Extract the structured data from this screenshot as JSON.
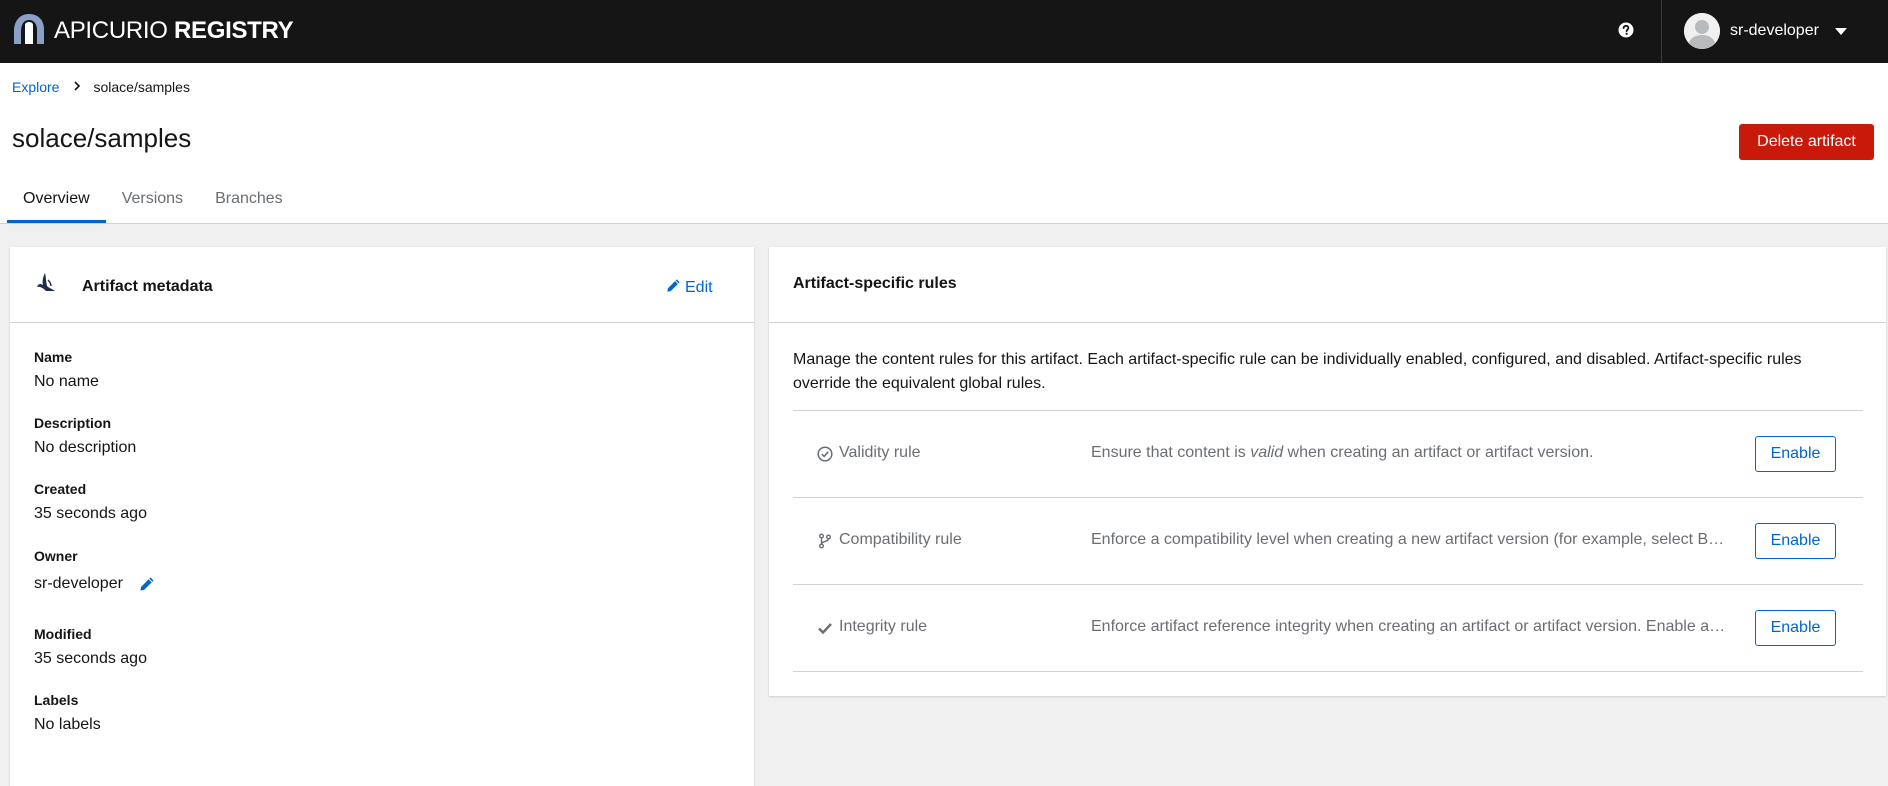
{
  "masthead": {
    "brand_thin": "APICURIO",
    "brand_bold": "REGISTRY",
    "username": "sr-developer",
    "icons": {
      "logo": "apicurio-logo-icon",
      "help": "help-icon",
      "avatar": "avatar-icon",
      "caret": "caret-down-icon"
    }
  },
  "breadcrumb": {
    "root": "Explore",
    "current": "solace/samples"
  },
  "page": {
    "title": "solace/samples",
    "delete_label": "Delete artifact"
  },
  "tabs": [
    {
      "label": "Overview",
      "active": true
    },
    {
      "label": "Versions",
      "active": false
    },
    {
      "label": "Branches",
      "active": false
    }
  ],
  "metadata_card": {
    "title": "Artifact metadata",
    "edit_label": "Edit",
    "fields": {
      "name": {
        "label": "Name",
        "value": "No name"
      },
      "description": {
        "label": "Description",
        "value": "No description"
      },
      "created": {
        "label": "Created",
        "value": "35 seconds ago"
      },
      "owner": {
        "label": "Owner",
        "value": "sr-developer"
      },
      "modified": {
        "label": "Modified",
        "value": "35 seconds ago"
      },
      "labels": {
        "label": "Labels",
        "value": "No labels"
      }
    }
  },
  "rules_card": {
    "title": "Artifact-specific rules",
    "description": "Manage the content rules for this artifact. Each artifact-specific rule can be individually enabled, configured, and disabled. Artifact-specific rules override the equivalent global rules.",
    "rules": [
      {
        "name": "Validity rule",
        "icon": "check-circle-icon",
        "desc_pre": "Ensure that content is ",
        "desc_em": "valid",
        "desc_post": " when creating an artifact or artifact version.",
        "button": "Enable"
      },
      {
        "name": "Compatibility rule",
        "icon": "code-branch-icon",
        "desc": "Enforce a compatibility level when creating a new artifact version (for example, select Backward for backwards compatibility).",
        "button": "Enable"
      },
      {
        "name": "Integrity rule",
        "icon": "check-icon",
        "desc": "Enforce artifact reference integrity when creating an artifact or artifact version. Enable and configure this rule to ensure that artifact references are valid.",
        "button": "Enable"
      }
    ]
  },
  "colors": {
    "masthead": "#151515",
    "link": "#0066cc",
    "danger": "#c9190b",
    "muted": "#6a6e73",
    "border": "#d2d2d2",
    "background": "#f0f0f0"
  }
}
